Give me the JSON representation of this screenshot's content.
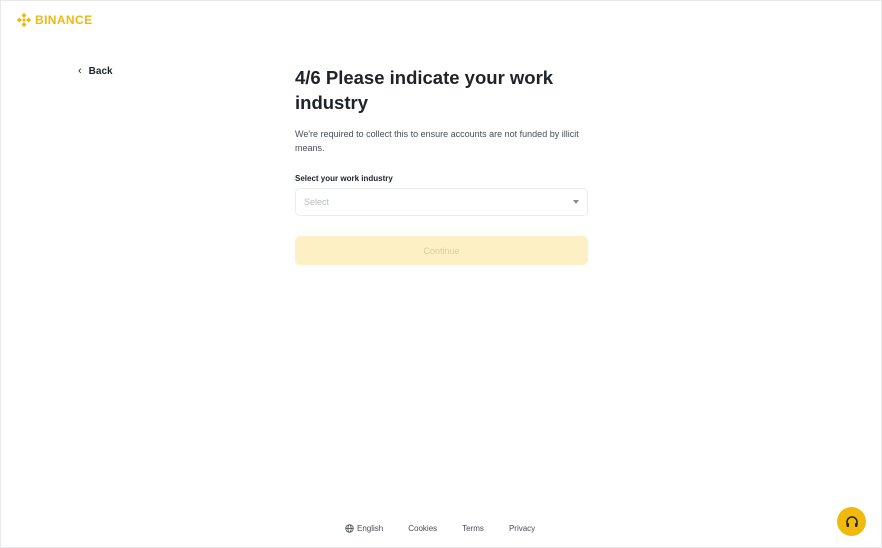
{
  "brand": {
    "name": "BINANCE",
    "color": "#f0b90b"
  },
  "nav": {
    "back_label": "Back",
    "back_icon": "chevron-left-icon"
  },
  "form": {
    "title": "4/6 Please indicate your work industry",
    "subtitle": "We're required to collect this to ensure accounts are not funded by illicit means.",
    "field_label": "Select your work industry",
    "select_placeholder": "Select",
    "continue_label": "Continue",
    "continue_color": "#fcf0c4"
  },
  "footer": {
    "language": "English",
    "links": [
      "Cookies",
      "Terms",
      "Privacy"
    ]
  },
  "support": {
    "icon": "headset-icon",
    "color": "#f0b90b"
  }
}
